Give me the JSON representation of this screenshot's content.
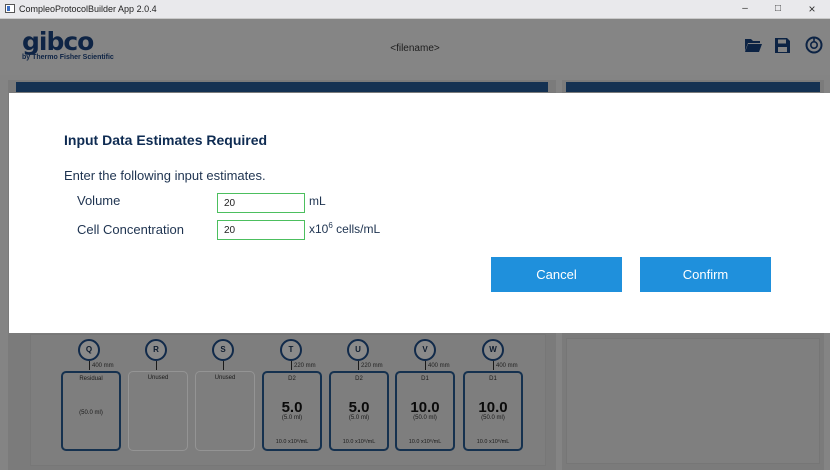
{
  "window": {
    "title": "CompleoProtocolBuilder App 2.0.4",
    "minimize": "–",
    "maximize": "□",
    "close": "×"
  },
  "header": {
    "logo": "gibco",
    "logo_sub": "by Thermo Fisher Scientific",
    "filename": "<filename>",
    "icons": [
      "folder-open-icon",
      "save-icon",
      "help-icon"
    ]
  },
  "ports": [
    {
      "letter": "Q",
      "tube": "400 mm",
      "bag": {
        "name": "Residual",
        "volume": "",
        "ml": "(50.0 ml)",
        "conc": "",
        "used": true
      }
    },
    {
      "letter": "R",
      "tube": "",
      "bag": {
        "name": "Unused",
        "volume": "",
        "ml": "",
        "conc": "",
        "used": false
      }
    },
    {
      "letter": "S",
      "tube": "",
      "bag": {
        "name": "Unused",
        "volume": "",
        "ml": "",
        "conc": "",
        "used": false
      }
    },
    {
      "letter": "T",
      "tube": "220 mm",
      "bag": {
        "name": "D2",
        "volume": "5.0",
        "ml": "(5.0 ml)",
        "conc": "10.0 x10⁶/mL",
        "used": true
      }
    },
    {
      "letter": "U",
      "tube": "220 mm",
      "bag": {
        "name": "D2",
        "volume": "5.0",
        "ml": "(5.0 ml)",
        "conc": "10.0 x10⁶/mL",
        "used": true
      }
    },
    {
      "letter": "V",
      "tube": "400 mm",
      "bag": {
        "name": "D1",
        "volume": "10.0",
        "ml": "(50.0 ml)",
        "conc": "10.0 x10⁶/mL",
        "used": true
      }
    },
    {
      "letter": "W",
      "tube": "400 mm",
      "bag": {
        "name": "D1",
        "volume": "10.0",
        "ml": "(50.0 ml)",
        "conc": "10.0 x10⁶/mL",
        "used": true
      }
    }
  ],
  "dialog": {
    "title": "Input Data Estimates Required",
    "instruction": "Enter the following input estimates.",
    "fields": [
      {
        "label": "Volume",
        "value": "20",
        "unit": "mL"
      },
      {
        "label": "Cell Concentration",
        "value": "20",
        "unit_prefix": "x10",
        "unit_sup": "6",
        "unit_suffix": " cells/mL"
      }
    ],
    "cancel": "Cancel",
    "confirm": "Confirm"
  },
  "colors": {
    "navy": "#0e2b52",
    "button_blue": "#1f90dc",
    "input_border": "#4cbf5e"
  }
}
